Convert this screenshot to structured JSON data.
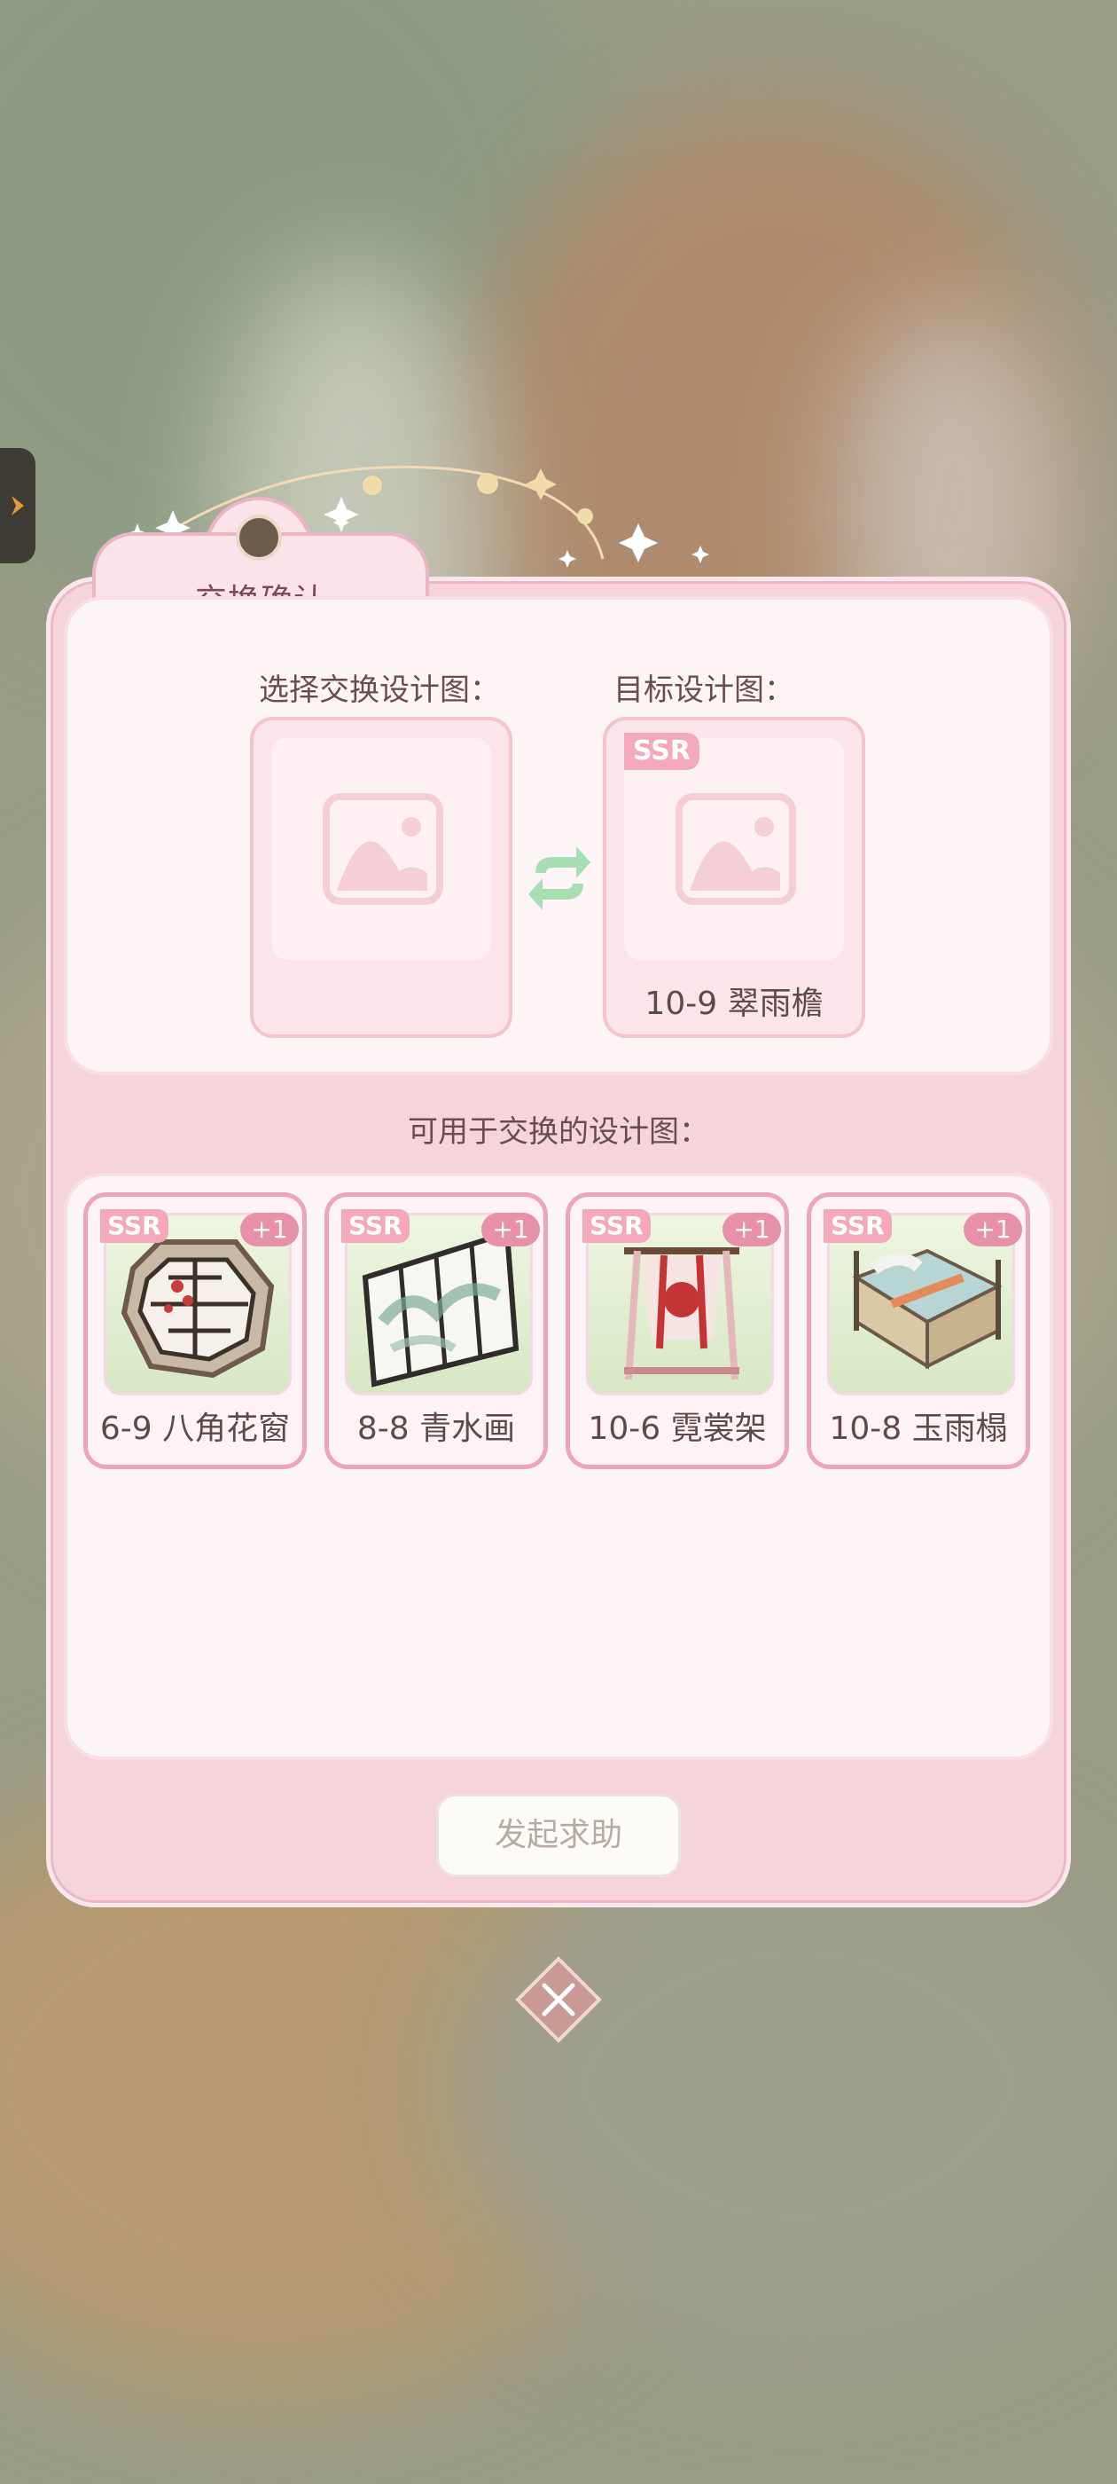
{
  "dialog": {
    "title": "交换确认",
    "select_label": "选择交换设计图：",
    "target_label": "目标设计图：",
    "target": {
      "rarity": "SSR",
      "name": "10-9 翠雨檐"
    },
    "available_label": "可用于交换的设计图：",
    "cards": [
      {
        "rarity": "SSR",
        "count": "+1",
        "name": "6-9 八角花窗",
        "icon": "octagonal-window-icon"
      },
      {
        "rarity": "SSR",
        "count": "+1",
        "name": "8-8 青水画",
        "icon": "ink-screen-icon"
      },
      {
        "rarity": "SSR",
        "count": "+1",
        "name": "10-6 霓裳架",
        "icon": "clothes-rack-icon"
      },
      {
        "rarity": "SSR",
        "count": "+1",
        "name": "10-8 玉雨榻",
        "icon": "bed-icon"
      }
    ],
    "help_button": "发起求助"
  },
  "colors": {
    "panel": "#f6d4dc",
    "badge": "#f4a8bc",
    "plus": "#e890a8",
    "text": "#5e4a49"
  }
}
